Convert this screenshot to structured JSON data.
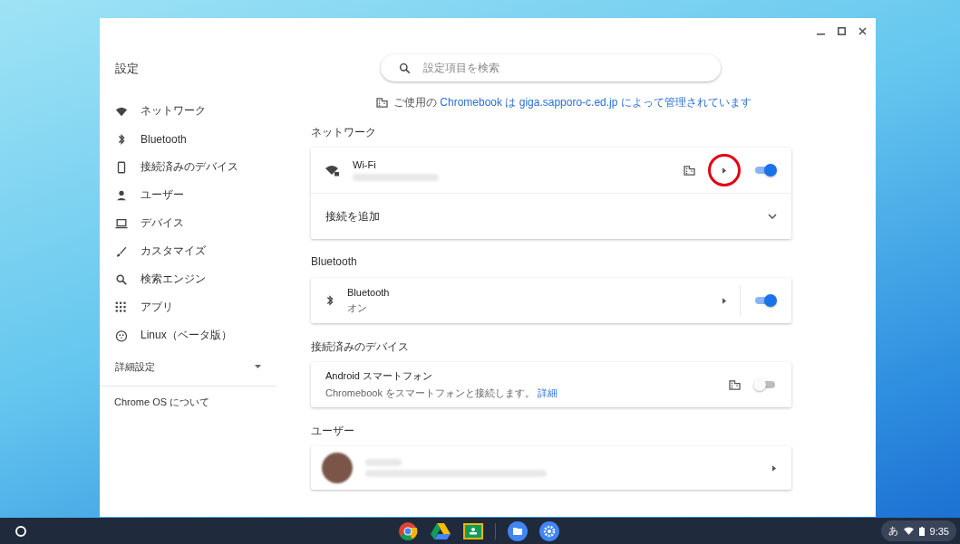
{
  "window": {
    "title": "設定"
  },
  "search": {
    "placeholder": "設定項目を検索"
  },
  "sidebar": {
    "items": [
      {
        "label": "ネットワーク",
        "kind": "wifi"
      },
      {
        "label": "Bluetooth",
        "kind": "bluetooth"
      },
      {
        "label": "接続済みのデバイス",
        "kind": "phone"
      },
      {
        "label": "ユーザー",
        "kind": "person"
      },
      {
        "label": "デバイス",
        "kind": "laptop"
      },
      {
        "label": "カスタマイズ",
        "kind": "brush"
      },
      {
        "label": "検索エンジン",
        "kind": "search"
      },
      {
        "label": "アプリ",
        "kind": "apps"
      },
      {
        "label": "Linux（ベータ版）",
        "kind": "linux"
      }
    ],
    "advanced": {
      "label": "詳細設定",
      "expanded": false
    },
    "about": "Chrome OS について"
  },
  "managed_notice": {
    "prefix": "ご使用の",
    "link": "Chromebook は giga.sapporo-c.ed.jp によって管理されています"
  },
  "sections": [
    {
      "title": "ネットワーク",
      "rows": [
        {
          "kind": "wifi",
          "title": "Wi-Fi",
          "managed": true,
          "on": true
        },
        {
          "kind": "expand",
          "title": "接続を追加"
        }
      ]
    },
    {
      "title": "Bluetooth",
      "rows": [
        {
          "kind": "bluetooth",
          "title": "Bluetooth",
          "subtitle": "オン",
          "on": true
        }
      ]
    },
    {
      "title": "接続済みのデバイス",
      "rows": [
        {
          "kind": "device",
          "title": "Android スマートフォン",
          "subtitle": "Chromebook をスマートフォンと接続します。",
          "link": "詳細",
          "managed": true,
          "on": false
        }
      ]
    },
    {
      "title": "ユーザー",
      "rows": [
        {
          "kind": "user"
        }
      ]
    }
  ],
  "tray": {
    "ime": "あ",
    "time": "9:35"
  }
}
